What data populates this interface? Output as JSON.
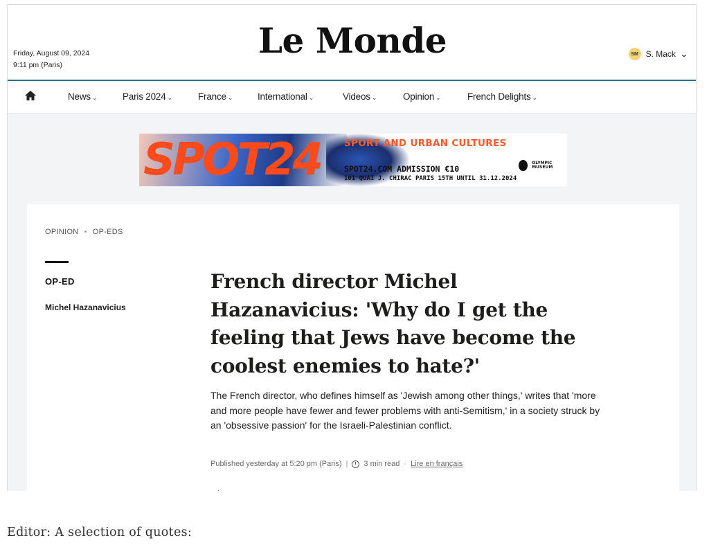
{
  "header": {
    "date": "Friday, August 09, 2024",
    "time": "9:11 pm (Paris)",
    "logo": "Le Monde",
    "user": {
      "initials": "SM",
      "name": "S. Mack",
      "icon": "chevron-down-icon"
    }
  },
  "nav": {
    "home_icon": "home-icon",
    "items": [
      {
        "label": "News"
      },
      {
        "label": "Paris 2024"
      },
      {
        "label": "France"
      },
      {
        "label": "International"
      },
      {
        "label": "Videos"
      },
      {
        "label": "Opinion"
      },
      {
        "label": "French Delights"
      }
    ],
    "caret": "⌄"
  },
  "ad": {
    "brand": "SPOT24",
    "tagline": "SPORT AND URBAN CULTURES",
    "line2": "SPOT24.COM ADMISSION €10",
    "line3": "101 QUAI J. CHIRAC PARIS 15TH UNTIL 31.12.2024",
    "partner": "OLYMPIC MUSEUM",
    "colors": {
      "orange": "#ff4a1c",
      "blue": "#1e3a86"
    }
  },
  "article": {
    "breadcrumb": [
      "OPINION",
      "OP-EDS"
    ],
    "section": "OP-ED",
    "author": "Michel Hazanavicius",
    "headline": "French director Michel Hazanavicius: 'Why do I get the feeling that Jews have become the coolest enemies to hate?'",
    "dek": "The French director, who defines himself as 'Jewish among other things,' writes that 'more and more people have fewer and fewer problems with anti-Semitism,' in a society struck by an 'obsessive passion' for the Israeli-Palestinian conflict.",
    "published": "Published yesterday at 5:20 pm (Paris)",
    "read_time": "3 min read",
    "french_link": "Lire en français"
  },
  "caption": "Editor: A selection of quotes:",
  "colors": {
    "nav_rule": "#2b6f93",
    "page_bg": "#f3f4f6"
  }
}
